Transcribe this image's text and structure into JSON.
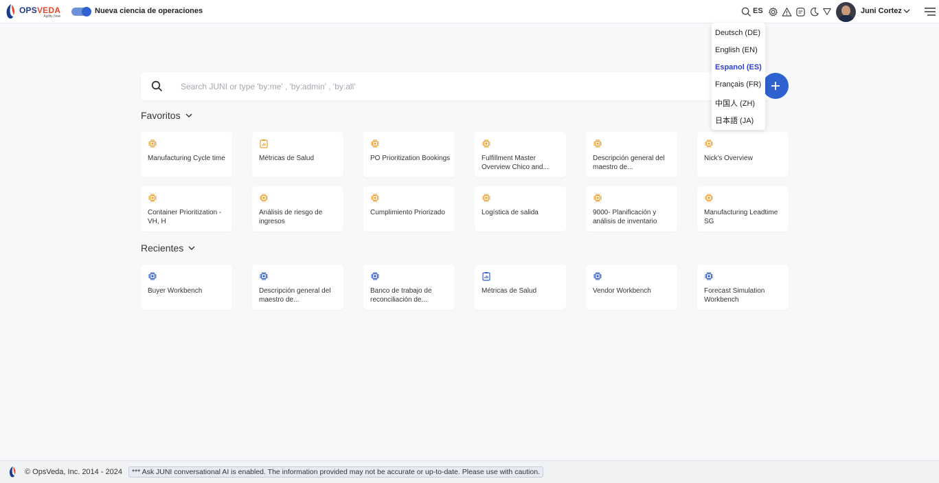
{
  "header": {
    "logo_word_main": "OPS",
    "logo_word_accent": "VEDA",
    "logo_tagline": "Agility Now",
    "toggle_label": "Nueva ciencia de operaciones",
    "lang_code": "ES",
    "username": "Juni Cortez"
  },
  "search": {
    "placeholder": "Search JUNI or type 'by:me' , 'by:admin' , 'by:all'",
    "value": ""
  },
  "add_button_label": "+",
  "favorites": {
    "title": "Favoritos",
    "items": [
      {
        "label": "Manufacturing Cycle time",
        "icon": "chip-icon"
      },
      {
        "label": "Métricas de Salud",
        "icon": "report-icon"
      },
      {
        "label": "PO Prioritization Bookings",
        "icon": "chip-icon"
      },
      {
        "label": "Fulfillment Master Overview Chico and...",
        "icon": "chip-icon"
      },
      {
        "label": "Descripción general del maestro de...",
        "icon": "chip-icon"
      },
      {
        "label": "Nick's Overview",
        "icon": "chip-icon"
      },
      {
        "label": "Container Prioritization - VH, H",
        "icon": "chip-icon"
      },
      {
        "label": "Análisis de riesgo de ingresos",
        "icon": "chip-icon"
      },
      {
        "label": "Cumplimiento Priorizado",
        "icon": "chip-icon"
      },
      {
        "label": "Logística de salida",
        "icon": "chip-icon"
      },
      {
        "label": "9000- Planificación y análisis de inventario",
        "icon": "chip-icon"
      },
      {
        "label": "Manufacturing Leadtime SG",
        "icon": "chip-icon"
      }
    ]
  },
  "recent": {
    "title": "Recientes",
    "items": [
      {
        "label": "Buyer Workbench",
        "icon": "chip-icon"
      },
      {
        "label": "Descripción general del maestro de...",
        "icon": "chip-icon"
      },
      {
        "label": "Banco de trabajo de reconciliación de...",
        "icon": "chip-icon"
      },
      {
        "label": "Métricas de Salud",
        "icon": "report-icon"
      },
      {
        "label": "Vendor Workbench",
        "icon": "chip-icon"
      },
      {
        "label": "Forecast Simulation Workbench",
        "icon": "chip-icon"
      }
    ]
  },
  "language_menu": {
    "items": [
      {
        "label": "Deutsch (DE)",
        "active": false
      },
      {
        "label": "English (EN)",
        "active": false
      },
      {
        "label": "Espanol (ES)",
        "active": true
      },
      {
        "label": "Français (FR)",
        "active": false
      },
      {
        "label": "中国人 (ZH)",
        "active": false
      },
      {
        "label": "日本語 (JA)",
        "active": false
      }
    ]
  },
  "footer": {
    "copyright": "© OpsVeda, Inc. 2014 - 2024",
    "notice": "*** Ask JUNI conversational AI is enabled. The information provided may not be accurate or up-to-date. Please use with caution."
  },
  "colors": {
    "accent": "#2f62d0",
    "favorite_icon": "#f0a030",
    "recent_icon": "#2f5bc8",
    "active_language": "#2f3fd6"
  }
}
